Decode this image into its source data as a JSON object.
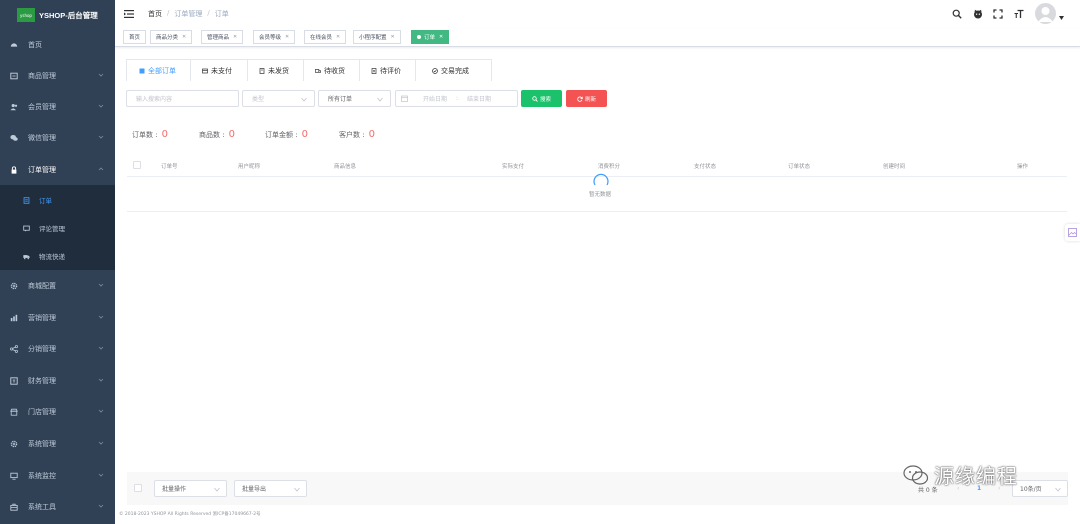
{
  "app": {
    "logo_text": "yshop",
    "title": "YSHOP-后台管理"
  },
  "sidebar": {
    "items": [
      {
        "label": "首页",
        "icon": "dashboard-icon"
      },
      {
        "label": "商品管理",
        "icon": "goods-icon"
      },
      {
        "label": "会员管理",
        "icon": "users-icon"
      },
      {
        "label": "微信管理",
        "icon": "wechat-icon"
      },
      {
        "label": "订单管理",
        "icon": "lock-icon"
      },
      {
        "label": "商城配置",
        "icon": "gear-icon"
      },
      {
        "label": "营销管理",
        "icon": "chart-icon"
      },
      {
        "label": "分销管理",
        "icon": "share-icon"
      },
      {
        "label": "财务管理",
        "icon": "finance-icon"
      },
      {
        "label": "门店管理",
        "icon": "store-icon"
      },
      {
        "label": "系统管理",
        "icon": "system-gear-icon"
      },
      {
        "label": "系统监控",
        "icon": "monitor-icon"
      },
      {
        "label": "系统工具",
        "icon": "toolbox-icon"
      }
    ],
    "sub_items": [
      {
        "label": "订单",
        "icon": "order-doc-icon"
      },
      {
        "label": "评论管理",
        "icon": "comment-icon"
      },
      {
        "label": "物流快递",
        "icon": "truck-icon"
      }
    ]
  },
  "breadcrumb": {
    "home": "首页",
    "sep": "/",
    "level1": "订单管理",
    "current": "订单"
  },
  "tags": [
    {
      "label": "首页"
    },
    {
      "label": "商品分类"
    },
    {
      "label": "管理商品"
    },
    {
      "label": "会员等级"
    },
    {
      "label": "在线会员"
    },
    {
      "label": "小程序配置"
    },
    {
      "label": "订单"
    }
  ],
  "tabs": [
    {
      "label": "全部订单"
    },
    {
      "label": "未支付"
    },
    {
      "label": "未发货"
    },
    {
      "label": "待收货"
    },
    {
      "label": "待评价"
    },
    {
      "label": "交易完成"
    }
  ],
  "filters": {
    "search_placeholder": "输入搜索内容",
    "type_placeholder": "类型",
    "order_type_value": "所有订单",
    "start_date_placeholder": "开始日期",
    "date_sep": ":",
    "end_date_placeholder": "结束日期",
    "search_button": "搜索",
    "reset_button": "刷新"
  },
  "stats": [
    {
      "label": "订单数 :",
      "value": "0"
    },
    {
      "label": "商品数 :",
      "value": "0"
    },
    {
      "label": "订单金额 :",
      "value": "0"
    },
    {
      "label": "客户数 :",
      "value": "0"
    }
  ],
  "table": {
    "columns": [
      "订单号",
      "用户昵称",
      "商品信息",
      "实际支付",
      "消费积分",
      "支付状态",
      "订单状态",
      "创建时间",
      "操作"
    ],
    "empty_text": "暂无数据"
  },
  "footer": {
    "batch_action": "批量操作",
    "batch_export": "批量导出",
    "total": "共 0 条",
    "page": "1",
    "page_size": "10条/页",
    "copyright": "© 2018-2023 YSHOP All Rights Reserved   浙ICP备17049667-2号"
  },
  "watermark": "源缘编程",
  "colors": {
    "sidebar_bg": "#304156",
    "primary": "#409eff",
    "tag_active": "#42b983",
    "search_button": "#1bc26b",
    "reset_button": "#f35353",
    "stat_value": "#f56c6c"
  }
}
